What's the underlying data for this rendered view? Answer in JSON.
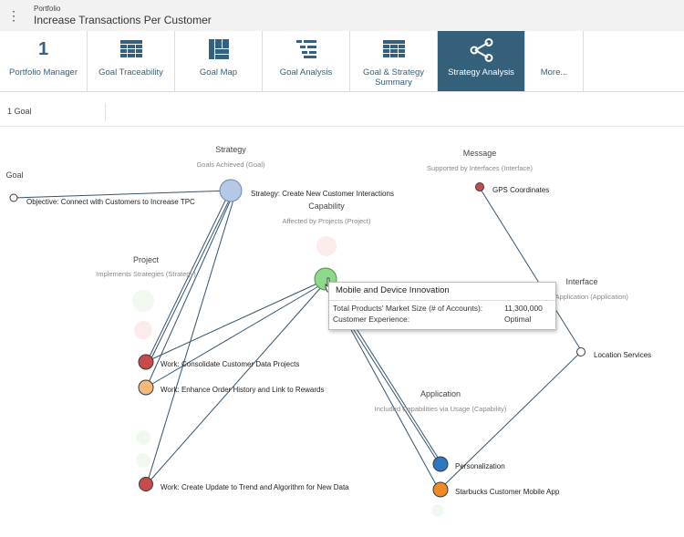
{
  "header": {
    "breadcrumb": "Portfolio",
    "title": "Increase Transactions Per Customer"
  },
  "tabs": [
    {
      "label": "Portfolio Manager",
      "icon": "number-icon",
      "icon_text": "1"
    },
    {
      "label": "Goal Traceability",
      "icon": "grid-icon"
    },
    {
      "label": "Goal Map",
      "icon": "map-icon"
    },
    {
      "label": "Goal Analysis",
      "icon": "list-icon"
    },
    {
      "label": "Goal & Strategy Summary",
      "icon": "grid-icon"
    },
    {
      "label": "Strategy Analysis",
      "icon": "share-network-icon",
      "active": true
    },
    {
      "label": "More...",
      "icon": ""
    }
  ],
  "subbar": {
    "count": "1 Goal"
  },
  "columns": {
    "goal": {
      "title": "Goal"
    },
    "strategy": {
      "title": "Strategy",
      "subtitle": "Goals Achieved (Goal)"
    },
    "capability": {
      "title": "Capability",
      "subtitle": "Affected by Projects (Project)"
    },
    "project": {
      "title": "Project",
      "subtitle": "Implements Strategies (Strategy)"
    },
    "message": {
      "title": "Message",
      "subtitle": "Supported by Interfaces (Interface)"
    },
    "interface": {
      "title": "Interface",
      "subtitle": "y Application (Application)"
    },
    "application": {
      "title": "Application",
      "subtitle": "Included Capabilities via Usage (Capability)"
    }
  },
  "nodes": {
    "objective": {
      "label": "Objective: Connect with Customers to Increase TPC",
      "color": "#ffffff"
    },
    "strategy": {
      "label": "Strategy: Create New Customer Interactions",
      "color": "#b4c8e8"
    },
    "capability": {
      "label": "Mobile and Device Innovation",
      "color": "#8fd98a"
    },
    "message": {
      "label": "GPS Coordinates",
      "color": "#c94a4a"
    },
    "interface": {
      "label": "Location Services",
      "color": "#ffffff"
    },
    "project1": {
      "label": "Work: Consolidate Customer Data Projects",
      "color": "#c94a4a"
    },
    "project2": {
      "label": "Work: Enhance Order History and Link to Rewards",
      "color": "#f5b97a"
    },
    "project3": {
      "label": "Work: Create Update to Trend and Algorithm for New Data",
      "color": "#c94a4a"
    },
    "app1": {
      "label": "Personalization",
      "color": "#2f78bf"
    },
    "app2": {
      "label": "Starbucks Customer Mobile App",
      "color": "#f08a24"
    }
  },
  "tooltip": {
    "title": "Mobile and Device Innovation",
    "rows": [
      {
        "label": "Total Products' Market Size (# of Accounts):",
        "value": "11,300,000"
      },
      {
        "label": "Customer Experience:",
        "value": "Optimal"
      }
    ]
  }
}
